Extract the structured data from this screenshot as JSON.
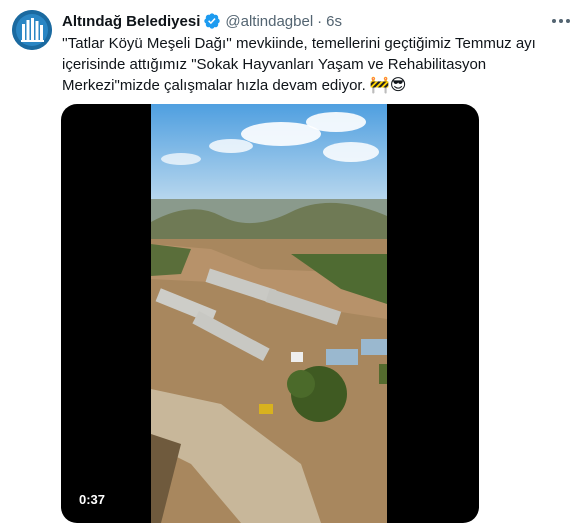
{
  "account": {
    "display_name": "Altındağ Belediyesi",
    "handle": "@altindagbel",
    "separator": "·",
    "time": "6s",
    "verified_color": "#1d9bf0"
  },
  "tweet": {
    "text": "''Tatlar Köyü Meşeli Dağı'' mevkiinde, temellerini geçtiğimiz Temmuz ayı içerisinde attığımız \"Sokak Hayvanları Yaşam ve Rehabilitasyon Merkezi\"mizde çalışmalar hızla devam ediyor.",
    "emojis": "🚧😎"
  },
  "media": {
    "type": "video",
    "duration": "0:37"
  },
  "icons": {
    "avatar": "municipality-logo",
    "verified": "verified-badge-icon",
    "more": "more-options-icon"
  }
}
